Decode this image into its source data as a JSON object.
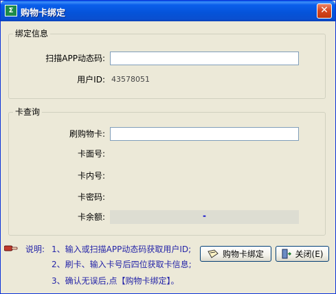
{
  "window": {
    "title": "购物卡绑定",
    "close_glyph": "✕"
  },
  "bind_group": {
    "legend": "绑定信息",
    "scan_label": "扫描APP动态码:",
    "scan_value": "",
    "userid_label": "用户ID:",
    "userid_value": "43578051"
  },
  "query_group": {
    "legend": "卡查询",
    "swipe_label": "刷购物卡:",
    "swipe_value": "",
    "face_label": "卡面号:",
    "inner_label": "卡内号:",
    "pin_label": "卡密码:",
    "balance_label": "卡余额:",
    "balance_value": "-"
  },
  "notes": {
    "head": "说明:",
    "line1": "1、输入或扫描APP动态码获取用户ID;",
    "line2": "2、刷卡、输入卡号后四位获取卡信息;",
    "line3": "3、确认无误后,点【购物卡绑定】。"
  },
  "buttons": {
    "bind_label": "购物卡绑定",
    "close_label": "关闭(E)"
  },
  "colors": {
    "title_bar": "#0A5FEB",
    "note_text": "#2424A8",
    "balance_value": "#0000CC"
  }
}
